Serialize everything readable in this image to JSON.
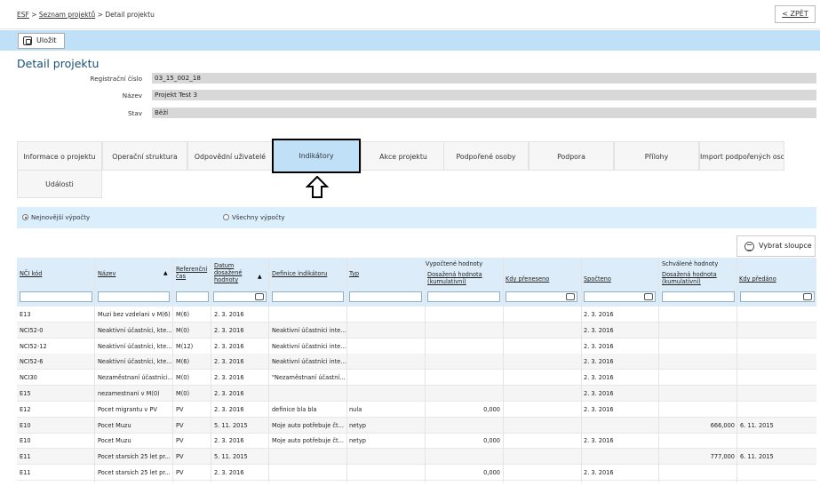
{
  "breadcrumb": {
    "items": [
      "ESF",
      "Seznam projektů",
      "Detail projektu"
    ],
    "separator": ">"
  },
  "back_label": "< ZPĚT",
  "toolbar": {
    "save_label": "Uložit"
  },
  "page_title": "Detail projektu",
  "fields": [
    {
      "label": "Registrační číslo",
      "value": "03_15_002_18"
    },
    {
      "label": "Název",
      "value": "Projekt Test 3"
    },
    {
      "label": "Stav",
      "value": "Běží"
    }
  ],
  "tabs": [
    "Informace o projektu",
    "Operační struktura",
    "Odpovědní uživatelé",
    "Indikátory",
    "Akce projektu",
    "Podpořené osoby",
    "Podpora",
    "Přílohy",
    "Import podpořených osob",
    "Události"
  ],
  "active_tab": "Indikátory",
  "filter": {
    "options": [
      "Nejnovější výpočty",
      "Všechny výpočty"
    ],
    "selected": "Nejnovější výpočty"
  },
  "columns_button": "Vybrat sloupce",
  "grid": {
    "group_computed": "Vypočtené hodnoty",
    "group_approved": "Schválené hodnoty",
    "columns": [
      "NČI kód",
      "Název",
      "Referenční čas",
      "Datum dosažené hodnoty",
      "Definice indikátoru",
      "Typ",
      "Dosažená hodnota (kumulativní)",
      "Kdy přeneseno",
      "Spočteno",
      "Dosažená hodnota (kumulativní)",
      "Kdy předáno"
    ],
    "rows": [
      [
        "E13",
        "Muzi bez vzdelani v M(6)",
        "M(6)",
        "2. 3. 2016",
        "",
        "",
        "",
        "",
        "2. 3. 2016",
        "",
        ""
      ],
      [
        "NCI52-0",
        "Neaktivní účastníci, kte...",
        "M(0)",
        "2. 3. 2016",
        "Neaktivní účastníci inte...",
        "",
        "",
        "",
        "2. 3. 2016",
        "",
        ""
      ],
      [
        "NCI52-12",
        "Neaktivní účastníci, kte...",
        "M(12)",
        "2. 3. 2016",
        "Neaktivní účastníci inte...",
        "",
        "",
        "",
        "2. 3. 2016",
        "",
        ""
      ],
      [
        "NCI52-6",
        "Neaktivní účastníci, kte...",
        "M(6)",
        "2. 3. 2016",
        "Neaktivní účastníci inte...",
        "",
        "",
        "",
        "2. 3. 2016",
        "",
        ""
      ],
      [
        "NCI30",
        "Nezaměstnaní účastníci...",
        "M(0)",
        "2. 3. 2016",
        "\"Nezaměstnaní účastní...",
        "",
        "",
        "",
        "2. 3. 2016",
        "",
        ""
      ],
      [
        "E15",
        "nezamestnani v M(0)",
        "M(0)",
        "2. 3. 2016",
        "",
        "",
        "",
        "",
        "2. 3. 2016",
        "",
        ""
      ],
      [
        "E12",
        "Pocet migrantu v PV",
        "PV",
        "2. 3. 2016",
        "definice bla bla",
        "nula",
        "0,000",
        "",
        "2. 3. 2016",
        "",
        ""
      ],
      [
        "E10",
        "Pocet Muzu",
        "PV",
        "5. 11. 2015",
        "Moje auto potřebuje čt...",
        "netyp",
        "",
        "",
        "",
        "666,000",
        "6. 11. 2015"
      ],
      [
        "E10",
        "Pocet Muzu",
        "PV",
        "2. 3. 2016",
        "Moje auto potřebuje čt...",
        "netyp",
        "0,000",
        "",
        "2. 3. 2016",
        "",
        ""
      ],
      [
        "E11",
        "Pocet starsich 25 let pr...",
        "PV",
        "5. 11. 2015",
        "",
        "",
        "",
        "",
        "",
        "777,000",
        "6. 11. 2015"
      ],
      [
        "E11",
        "Pocet starsich 25 let pr...",
        "PV",
        "2. 3. 2016",
        "",
        "",
        "0,000",
        "",
        "2. 3. 2016",
        "",
        ""
      ]
    ]
  },
  "icons": {
    "save": "save-icon",
    "columns": "columns-icon",
    "arrow": "up-arrow-icon",
    "calendar": "calendar-icon",
    "sort": "sort-arrow-icon"
  },
  "colors": {
    "accent_light": "#bfe0f7",
    "title": "#1a4f73",
    "field_bg": "#d8d8d8"
  }
}
